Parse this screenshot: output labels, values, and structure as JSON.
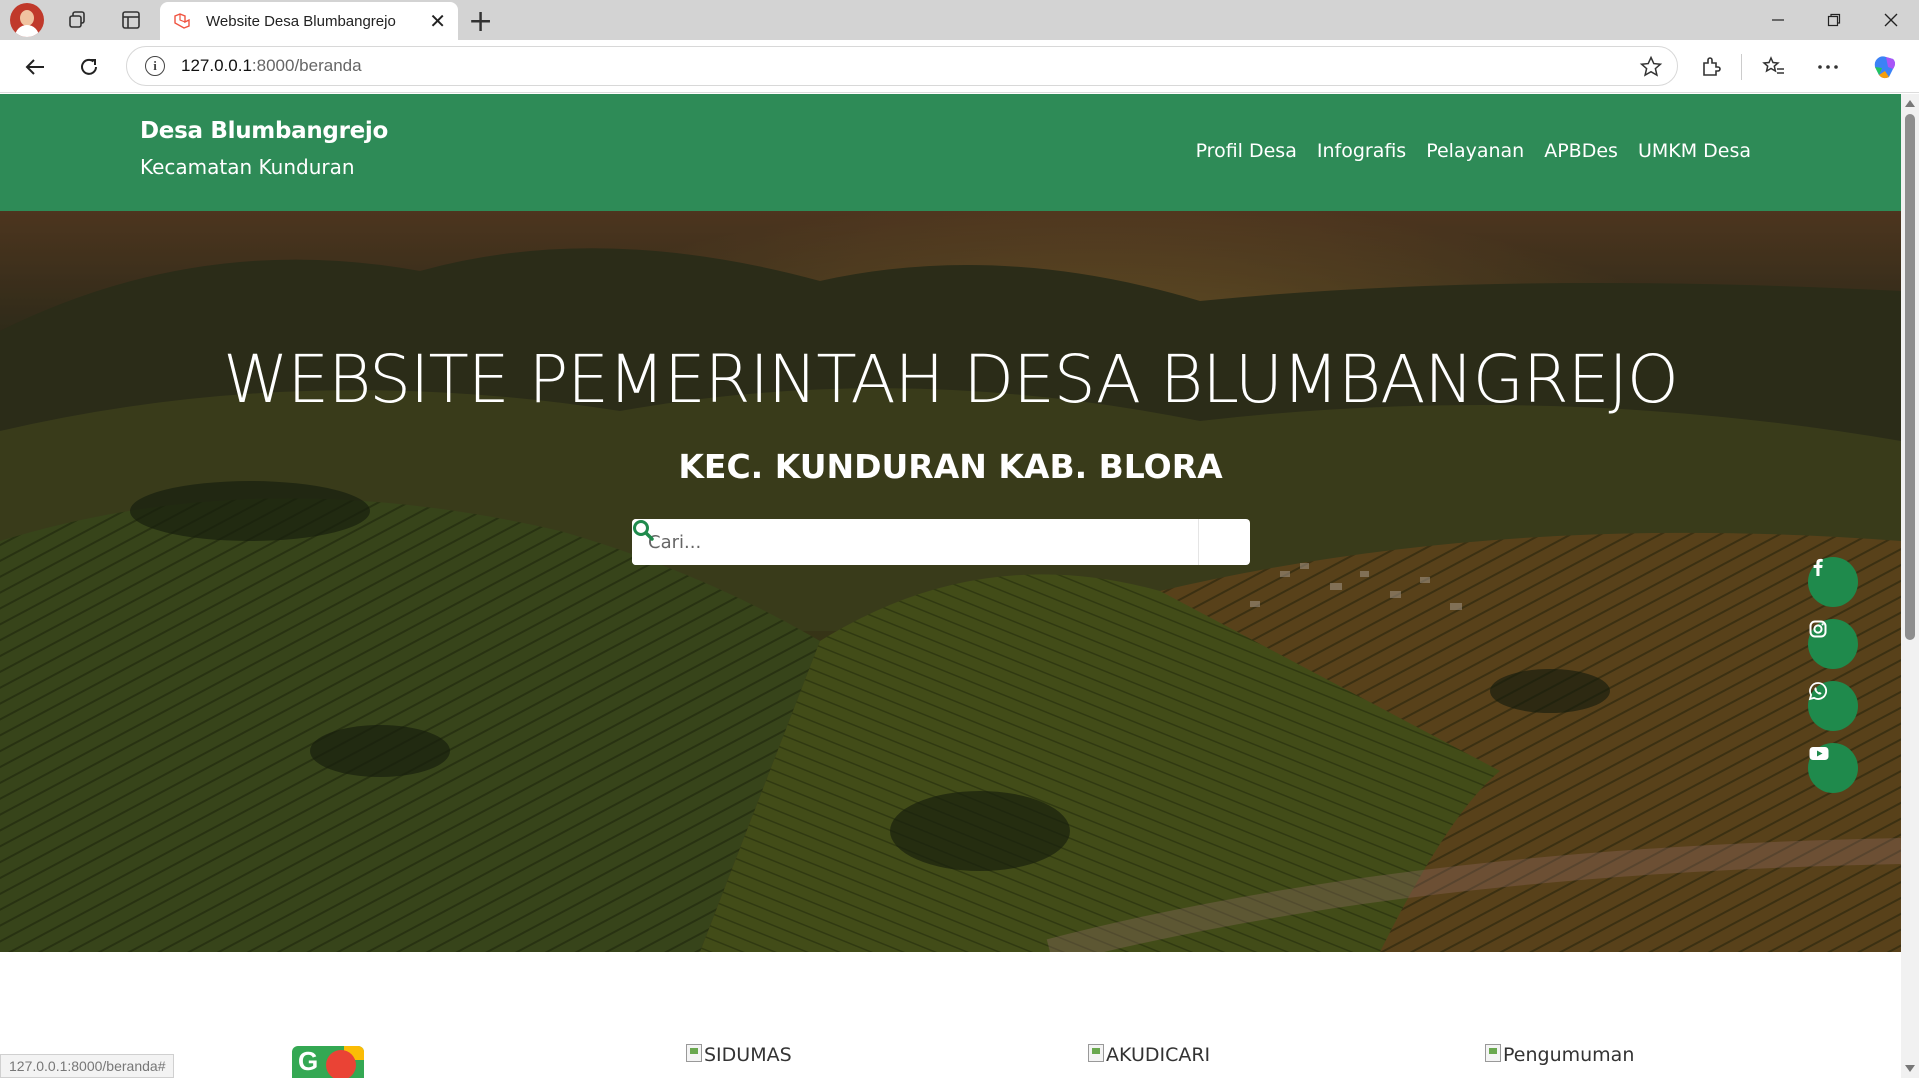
{
  "browser": {
    "tab_title": "Website Desa Blumbangrejo",
    "url_host": "127.0.0.1",
    "url_path": ":8000/beranda",
    "status_url": "127.0.0.1:8000/beranda#"
  },
  "site": {
    "brand_name": "Desa Blumbangrejo",
    "brand_sub": "Kecamatan Kunduran",
    "nav": [
      "Profil Desa",
      "Infografis",
      "Pelayanan",
      "APBDes",
      "UMKM Desa"
    ],
    "accent_color": "#2e8b57"
  },
  "hero": {
    "title": "WEBSITE PEMERINTAH DESA BLUMBANGREJO",
    "subtitle": "KEC. KUNDURAN KAB. BLORA",
    "search_placeholder": "Cari..."
  },
  "social": [
    "facebook-icon",
    "instagram-icon",
    "whatsapp-icon",
    "youtube-icon"
  ],
  "services": [
    "SIDUMAS",
    "AKUDICARI",
    "Pengumuman"
  ]
}
